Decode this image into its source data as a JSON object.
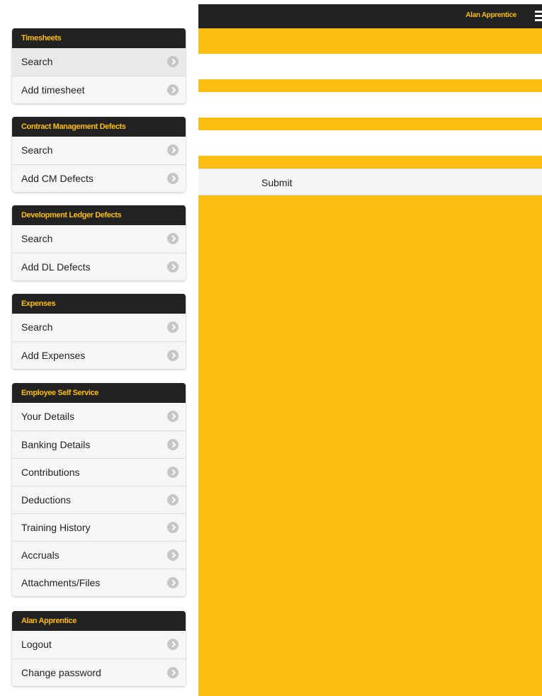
{
  "header": {
    "user_name": "Alan Apprentice",
    "menu_icon": "hamburger-icon"
  },
  "form": {
    "submit_label": "Submit"
  },
  "colors": {
    "accent": "#fbbd11",
    "header_bg": "#222222",
    "item_bg": "#f6f6f6"
  },
  "menu": {
    "timesheets": {
      "title": "Timesheets",
      "items": [
        "Search",
        "Add timesheet"
      ]
    },
    "cm_defects": {
      "title": "Contract Management Defects",
      "items": [
        "Search",
        "Add CM Defects"
      ]
    },
    "dl_defects": {
      "title": "Development Ledger Defects",
      "items": [
        "Search",
        "Add DL Defects"
      ]
    },
    "expenses": {
      "title": "Expenses",
      "items": [
        "Search",
        "Add Expenses"
      ]
    },
    "ess": {
      "title": "Employee Self Service",
      "items": [
        "Your Details",
        "Banking Details",
        "Contributions",
        "Deductions",
        "Training History",
        "Accruals",
        "Attachments/Files"
      ]
    },
    "account": {
      "title": "Alan Apprentice",
      "items": [
        "Logout",
        "Change password"
      ]
    },
    "item_icon": "chevron-right-circle-icon"
  }
}
